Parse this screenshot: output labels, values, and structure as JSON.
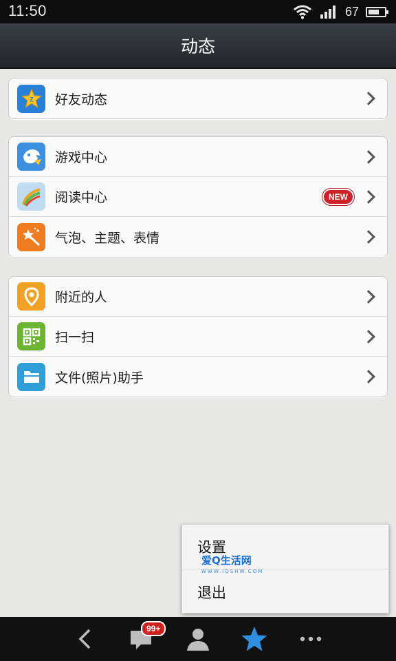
{
  "status_bar": {
    "time": "11:50",
    "battery_level": "67"
  },
  "header": {
    "title": "动态"
  },
  "groups": [
    {
      "items": [
        {
          "label": "好友动态",
          "icon": "qzone-star-icon",
          "color": "#2a7fd6"
        }
      ]
    },
    {
      "items": [
        {
          "label": "游戏中心",
          "icon": "game-center-icon",
          "color": "#3d8fe0"
        },
        {
          "label": "阅读中心",
          "icon": "reading-center-icon",
          "color": "#9cc6e8",
          "badge": "NEW"
        },
        {
          "label": "气泡、主题、表情",
          "icon": "magic-wand-icon",
          "color": "#f07c22"
        }
      ]
    },
    {
      "items": [
        {
          "label": "附近的人",
          "icon": "location-pin-icon",
          "color": "#f0a224"
        },
        {
          "label": "扫一扫",
          "icon": "qr-code-icon",
          "color": "#6bb532"
        },
        {
          "label": "文件(照片)助手",
          "icon": "folder-icon",
          "color": "#2f9ed6"
        }
      ]
    }
  ],
  "popup_menu": {
    "items": [
      "设置",
      "退出"
    ],
    "watermark": "爱Q生活网",
    "watermark_url": "WWW.IQSHW.COM"
  },
  "bottom_nav": {
    "message_badge": "99+",
    "icons": [
      "back-icon",
      "messages-icon",
      "contacts-icon",
      "favorites-star-icon",
      "more-icon"
    ],
    "active_color": "#2f8fe0"
  }
}
